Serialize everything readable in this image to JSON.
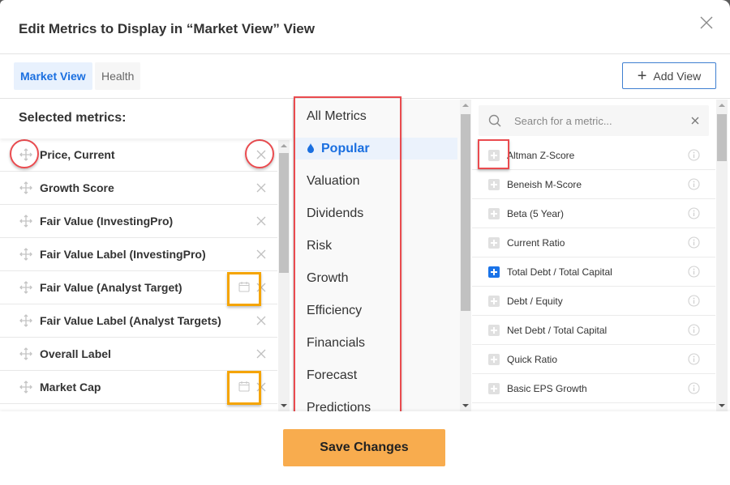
{
  "dialog": {
    "title": "Edit Metrics to Display in “Market View” View",
    "close_icon": "close-icon"
  },
  "tabs": [
    {
      "label": "Market View",
      "active": true
    },
    {
      "label": "Health",
      "active": false
    }
  ],
  "add_view": {
    "label": "Add View",
    "icon": "plus-icon"
  },
  "selected": {
    "heading": "Selected metrics:",
    "items": [
      {
        "label": "Price, Current",
        "calendar": false
      },
      {
        "label": "Growth Score",
        "calendar": false
      },
      {
        "label": "Fair Value (InvestingPro)",
        "calendar": false
      },
      {
        "label": "Fair Value Label (InvestingPro)",
        "calendar": false
      },
      {
        "label": "Fair Value (Analyst Target)",
        "calendar": true
      },
      {
        "label": "Fair Value Label (Analyst Targets)",
        "calendar": false
      },
      {
        "label": "Overall Label",
        "calendar": false
      },
      {
        "label": "Market Cap",
        "calendar": true
      }
    ]
  },
  "categories": {
    "items": [
      {
        "label": "All Metrics",
        "active": false
      },
      {
        "label": "Popular",
        "active": true,
        "icon": "drop-icon"
      },
      {
        "label": "Valuation",
        "active": false
      },
      {
        "label": "Dividends",
        "active": false
      },
      {
        "label": "Risk",
        "active": false
      },
      {
        "label": "Growth",
        "active": false
      },
      {
        "label": "Efficiency",
        "active": false
      },
      {
        "label": "Financials",
        "active": false
      },
      {
        "label": "Forecast",
        "active": false
      },
      {
        "label": "Predictions",
        "active": false
      }
    ]
  },
  "search": {
    "placeholder": "Search for a metric...",
    "value": ""
  },
  "metrics": {
    "items": [
      {
        "label": "Altman Z-Score",
        "added": false
      },
      {
        "label": "Beneish M-Score",
        "added": false
      },
      {
        "label": "Beta (5 Year)",
        "added": false
      },
      {
        "label": "Current Ratio",
        "added": false
      },
      {
        "label": "Total Debt / Total Capital",
        "added": true
      },
      {
        "label": "Debt / Equity",
        "added": false
      },
      {
        "label": "Net Debt / Total Capital",
        "added": false
      },
      {
        "label": "Quick Ratio",
        "added": false
      },
      {
        "label": "Basic EPS Growth",
        "added": false
      }
    ]
  },
  "footer": {
    "save_label": "Save Changes"
  },
  "colors": {
    "accent_blue": "#1a6fe0",
    "save_orange": "#f8ac4e",
    "annotation_red": "#ea4b4f",
    "annotation_orange": "#f5a400"
  }
}
